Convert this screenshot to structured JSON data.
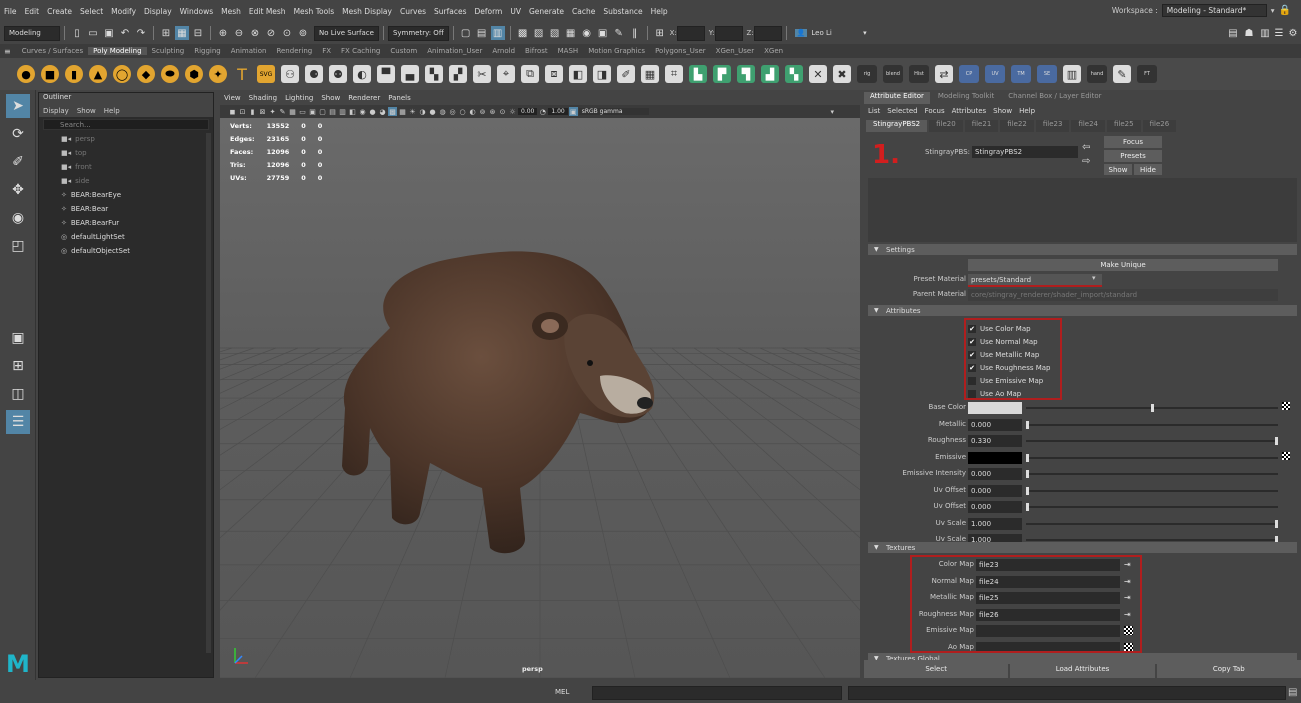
{
  "menubar": {
    "items": [
      "File",
      "Edit",
      "Create",
      "Select",
      "Modify",
      "Display",
      "Windows",
      "Mesh",
      "Edit Mesh",
      "Mesh Tools",
      "Mesh Display",
      "Curves",
      "Surfaces",
      "Deform",
      "UV",
      "Generate",
      "Cache",
      "Substance",
      "Help"
    ],
    "workspace_label": "Workspace :",
    "workspace_value": "Modeling - Standard*"
  },
  "statusline": {
    "mode": "Modeling",
    "live_surface": "No Live Surface",
    "symmetry": "Symmetry: Off",
    "x_label": "X:",
    "y_label": "Y:",
    "z_label": "Z:",
    "user": "Leo Li"
  },
  "shelf_tabs": [
    "Curves / Surfaces",
    "Poly Modeling",
    "Sculpting",
    "Rigging",
    "Animation",
    "Rendering",
    "FX",
    "FX Caching",
    "Custom",
    "Animation_User",
    "Arnold",
    "Bifrost",
    "MASH",
    "Motion Graphics",
    "Polygons_User",
    "XGen_User",
    "XGen"
  ],
  "shelf_active_tab": "Poly Modeling",
  "shelf_labels": [
    "rig",
    "blend",
    "Hist",
    "CP",
    "UV",
    "TM",
    "SE",
    "hand",
    "FT"
  ],
  "outliner": {
    "title": "Outliner",
    "menu": [
      "Display",
      "Show",
      "Help"
    ],
    "search_placeholder": "Search...",
    "items": [
      {
        "name": "persp",
        "dim": true,
        "icon": "camera-icon"
      },
      {
        "name": "top",
        "dim": true,
        "icon": "camera-icon"
      },
      {
        "name": "front",
        "dim": true,
        "icon": "camera-icon"
      },
      {
        "name": "side",
        "dim": true,
        "icon": "camera-icon"
      },
      {
        "name": "BEAR:BearEye",
        "dim": false,
        "icon": "transform-icon"
      },
      {
        "name": "BEAR:Bear",
        "dim": false,
        "icon": "transform-icon"
      },
      {
        "name": "BEAR:BearFur",
        "dim": false,
        "icon": "transform-icon"
      },
      {
        "name": "defaultLightSet",
        "dim": false,
        "icon": "set-icon"
      },
      {
        "name": "defaultObjectSet",
        "dim": false,
        "icon": "set-icon"
      }
    ]
  },
  "viewport": {
    "menu": [
      "View",
      "Shading",
      "Lighting",
      "Show",
      "Renderer",
      "Panels"
    ],
    "exposure": "0.00",
    "gamma": "1.00",
    "color_space": "sRGB gamma",
    "camera_label": "persp",
    "hud": [
      {
        "label": "Verts:",
        "v1": "13552",
        "v2": "0",
        "v3": "0"
      },
      {
        "label": "Edges:",
        "v1": "23165",
        "v2": "0",
        "v3": "0"
      },
      {
        "label": "Faces:",
        "v1": "12096",
        "v2": "0",
        "v3": "0"
      },
      {
        "label": "Tris:",
        "v1": "12096",
        "v2": "0",
        "v3": "0"
      },
      {
        "label": "UVs:",
        "v1": "27759",
        "v2": "0",
        "v3": "0"
      }
    ]
  },
  "attribute_editor": {
    "tabs": [
      "Attribute Editor",
      "Modeling Toolkit",
      "Channel Box / Layer Editor"
    ],
    "menu": [
      "List",
      "Selected",
      "Focus",
      "Attributes",
      "Show",
      "Help"
    ],
    "node_tabs": [
      "StingrayPBS2",
      "file20",
      "file21",
      "file22",
      "file23",
      "file24",
      "file25",
      "file26"
    ],
    "node_label": "StingrayPBS:",
    "node_value": "StingrayPBS2",
    "focus_btn": "Focus",
    "presets_btn": "Presets",
    "show_btn": "Show",
    "hide_btn": "Hide",
    "annotation": "1.",
    "settings": {
      "title": "Settings",
      "make_unique": "Make Unique",
      "preset_label": "Preset Material",
      "preset_value": "presets/Standard",
      "parent_label": "Parent Material",
      "parent_value": "core/stingray_renderer/shader_import/standard"
    },
    "attributes": {
      "title": "Attributes",
      "checks": [
        {
          "label": "Use Color Map",
          "checked": true
        },
        {
          "label": "Use Normal Map",
          "checked": true
        },
        {
          "label": "Use Metallic Map",
          "checked": true
        },
        {
          "label": "Use Roughness Map",
          "checked": true
        },
        {
          "label": "Use Emissive Map",
          "checked": false
        },
        {
          "label": "Use Ao Map",
          "checked": false
        }
      ],
      "rows": [
        {
          "label": "Base Color",
          "value": "",
          "kind": "color-light",
          "knob": 0.5
        },
        {
          "label": "Metallic",
          "value": "0.000",
          "kind": "num",
          "knob": 0.0
        },
        {
          "label": "Roughness",
          "value": "0.330",
          "kind": "num",
          "knob": 1.0
        },
        {
          "label": "Emissive",
          "value": "",
          "kind": "color-dark",
          "knob": 0.0
        },
        {
          "label": "Emissive Intensity",
          "value": "0.000",
          "kind": "num",
          "knob": 0.0
        },
        {
          "label": "Uv Offset",
          "value": "0.000",
          "kind": "num",
          "knob": 0.0
        },
        {
          "label": "Uv Offset",
          "value": "0.000",
          "kind": "num",
          "knob": 0.0
        },
        {
          "label": "Uv Scale",
          "value": "1.000",
          "kind": "num",
          "knob": 1.0
        },
        {
          "label": "Uv Scale",
          "value": "1.000",
          "kind": "num",
          "knob": 1.0
        }
      ]
    },
    "textures": {
      "title": "Textures",
      "rows": [
        {
          "label": "Color Map",
          "value": "file23"
        },
        {
          "label": "Normal Map",
          "value": "file24"
        },
        {
          "label": "Metallic Map",
          "value": "file25"
        },
        {
          "label": "Roughness Map",
          "value": "file26"
        },
        {
          "label": "Emissive Map",
          "value": ""
        },
        {
          "label": "Ao Map",
          "value": ""
        }
      ]
    },
    "textures_global": "Textures Global",
    "bottom": [
      "Select",
      "Load Attributes",
      "Copy Tab"
    ]
  },
  "cmdline": {
    "label": "MEL"
  },
  "colors": {
    "accent": "#5285a6",
    "annotation_red": "#b01e1e",
    "maya_logo": "#1fb5c9"
  }
}
